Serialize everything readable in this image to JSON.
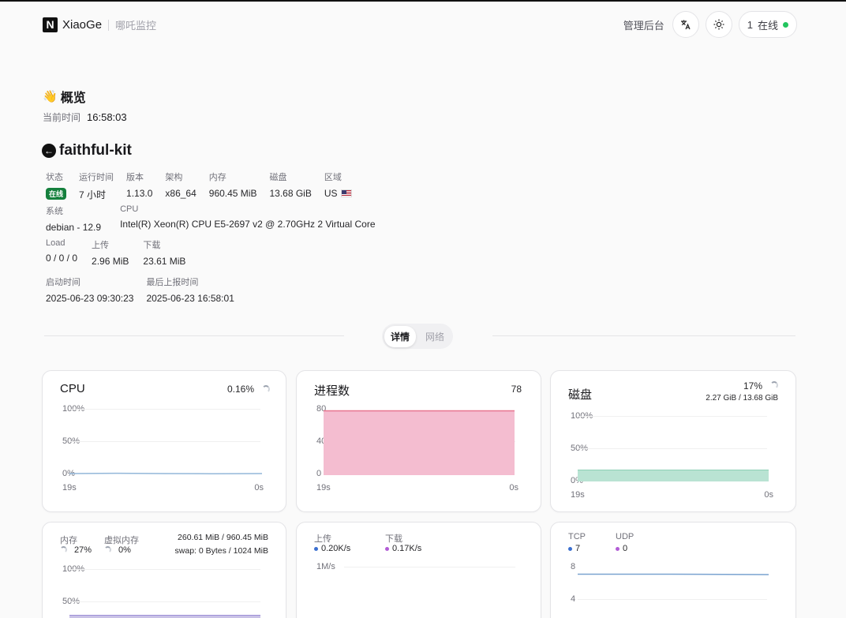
{
  "header": {
    "brand_letter": "N",
    "brand_name": "XiaoGe",
    "brand_sub": "哪吒监控",
    "admin_label": "管理后台",
    "translate_icon": "translate-icon",
    "theme_icon": "sun-icon",
    "online_count": "1",
    "online_label": "在线"
  },
  "overview": {
    "title": "概览",
    "time_label": "当前时间",
    "time_value": "16:58:03"
  },
  "server": {
    "name": "faithful-kit",
    "status_label": "状态",
    "status_value": "在线",
    "uptime_label": "运行时间",
    "uptime_value": "7 小时",
    "version_label": "版本",
    "version_value": "1.13.0",
    "arch_label": "架构",
    "arch_value": "x86_64",
    "mem_label": "内存",
    "mem_value": "960.45 MiB",
    "disk_label": "磁盘",
    "disk_value": "13.68 GiB",
    "region_label": "区域",
    "region_value": "US",
    "os_label": "系统",
    "os_value": "debian - 12.9",
    "cpu_label": "CPU",
    "cpu_value": "Intel(R) Xeon(R) CPU E5-2697 v2 @ 2.70GHz 2 Virtual Core",
    "load_label": "Load",
    "load_value": "0 / 0 / 0",
    "upload_label": "上传",
    "upload_value": "2.96 MiB",
    "download_label": "下载",
    "download_value": "23.61 MiB",
    "boot_label": "启动时间",
    "boot_value": "2025-06-23 09:30:23",
    "report_label": "最后上报时间",
    "report_value": "2025-06-23 16:58:01"
  },
  "tabs": [
    {
      "label": "详情",
      "active": true
    },
    {
      "label": "网络",
      "active": false
    }
  ],
  "cards": {
    "cpu": {
      "title": "CPU",
      "value": "0.16%",
      "y_labels": [
        "100%",
        "50%",
        "0%"
      ],
      "x_labels": [
        "19s",
        "0s"
      ]
    },
    "process": {
      "title": "进程数",
      "value": "78",
      "y_labels": [
        "80",
        "40",
        "0"
      ],
      "x_labels": [
        "19s",
        "0s"
      ]
    },
    "disk": {
      "title": "磁盘",
      "value": "17%",
      "detail": "2.27 GiB / 13.68 GiB",
      "y_labels": [
        "100%",
        "50%",
        "0%"
      ],
      "x_labels": [
        "19s",
        "0s"
      ]
    },
    "memory": {
      "mem_label": "内存",
      "mem_value": "27%",
      "swap_label": "虚拟内存",
      "swap_value": "0%",
      "detail": "260.61 MiB / 960.45 MiB",
      "swap_detail": "swap: 0 Bytes / 1024 MiB",
      "y_labels": [
        "100%",
        "50%"
      ]
    },
    "network": {
      "up_label": "上传",
      "up_value": "0.20K/s",
      "down_label": "下载",
      "down_value": "0.17K/s",
      "y_label": "1M/s"
    },
    "connections": {
      "tcp_label": "TCP",
      "tcp_value": "7",
      "udp_label": "UDP",
      "udp_value": "0",
      "y_labels": [
        "8",
        "4"
      ]
    }
  },
  "colors": {
    "online": "#22c55e",
    "process_fill": "#f4bdd0",
    "process_line": "#e7758f",
    "disk_fill": "#b9e3d3",
    "cpu_line": "#93b7d9",
    "mem_fill": "#c9c1e6",
    "upload_dot": "#3b6fd0",
    "download_dot": "#b25cd6"
  },
  "chart_data": [
    {
      "type": "line",
      "title": "CPU",
      "x": [
        "19s",
        "0s"
      ],
      "series": [
        {
          "values": [
            0.16,
            0.16
          ]
        }
      ],
      "ylim": [
        0,
        100
      ]
    },
    {
      "type": "area",
      "title": "进程数",
      "x": [
        "19s",
        "0s"
      ],
      "series": [
        {
          "values": [
            78,
            78
          ]
        }
      ],
      "ylim": [
        0,
        80
      ]
    },
    {
      "type": "area",
      "title": "磁盘",
      "x": [
        "19s",
        "0s"
      ],
      "series": [
        {
          "values": [
            17,
            17
          ]
        }
      ],
      "ylim": [
        0,
        100
      ]
    }
  ]
}
